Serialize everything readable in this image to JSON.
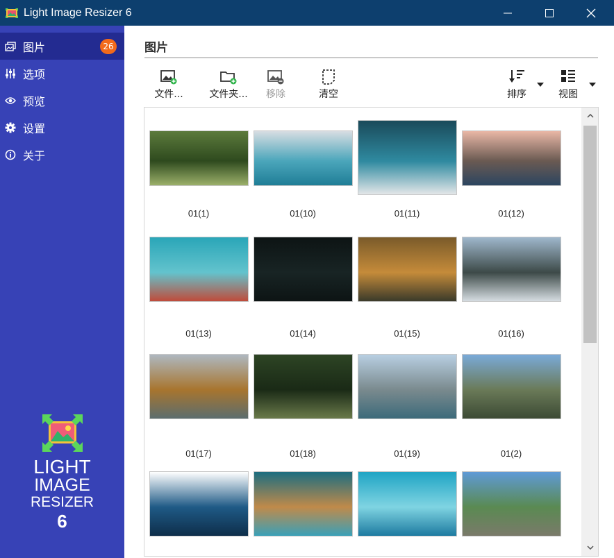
{
  "window": {
    "title": "Light Image Resizer 6"
  },
  "sidebar": {
    "items": [
      {
        "label": "图片",
        "badge": "26",
        "icon": "images-icon"
      },
      {
        "label": "选项",
        "icon": "sliders-icon"
      },
      {
        "label": "预览",
        "icon": "eye-icon"
      },
      {
        "label": "设置",
        "icon": "gear-icon"
      },
      {
        "label": "关于",
        "icon": "info-icon"
      }
    ],
    "logo": {
      "line1": "LIGHT",
      "line2": "IMAGE",
      "line3": "RESIZER",
      "line4": "6"
    }
  },
  "main": {
    "title": "图片",
    "toolbar": {
      "files": "文件...",
      "folder": "文件夹...",
      "remove": "移除",
      "clear": "清空",
      "sort": "排序",
      "view": "视图"
    },
    "thumbnails": [
      {
        "label": "01(1)",
        "colors": [
          "#5c7a3c",
          "#2e4a1e",
          "#9cb06a"
        ]
      },
      {
        "label": "01(10)",
        "colors": [
          "#d7dde2",
          "#4ba6bb",
          "#1f7d96"
        ]
      },
      {
        "label": "01(11)",
        "colors": [
          "#1a4a5a",
          "#2f8aa0",
          "#e3e6e8"
        ]
      },
      {
        "label": "01(12)",
        "colors": [
          "#e9b7a6",
          "#6a5a52",
          "#2c4560"
        ]
      },
      {
        "label": "01(13)",
        "colors": [
          "#2aa6b8",
          "#63c3cd",
          "#c04b3a"
        ]
      },
      {
        "label": "01(14)",
        "colors": [
          "#0d1414",
          "#182424",
          "#0d1414"
        ]
      },
      {
        "label": "01(15)",
        "colors": [
          "#7a5b2a",
          "#c58b3a",
          "#3a3a2a"
        ]
      },
      {
        "label": "01(16)",
        "colors": [
          "#9fb7cc",
          "#3d4a48",
          "#d6dde2"
        ]
      },
      {
        "label": "01(17)",
        "colors": [
          "#aeb8c0",
          "#a8752e",
          "#5b6d6e"
        ]
      },
      {
        "label": "01(18)",
        "colors": [
          "#2d4424",
          "#1a2a16",
          "#6a7a4a"
        ]
      },
      {
        "label": "01(19)",
        "colors": [
          "#b8cfe2",
          "#7a8a8e",
          "#3c6a7a"
        ]
      },
      {
        "label": "01(2)",
        "colors": [
          "#7aaad8",
          "#6a7a58",
          "#3c4a34"
        ]
      },
      {
        "label": "",
        "colors": [
          "#ffffff",
          "#1f5a86",
          "#0e2e4a"
        ]
      },
      {
        "label": "",
        "colors": [
          "#1c6d80",
          "#c08a4a",
          "#3aa0b8"
        ]
      },
      {
        "label": "",
        "colors": [
          "#1fa4c4",
          "#7fd4e2",
          "#1d7aa0"
        ]
      },
      {
        "label": "",
        "colors": [
          "#5f9ad6",
          "#5a8a52",
          "#7a7a6a"
        ]
      }
    ]
  }
}
